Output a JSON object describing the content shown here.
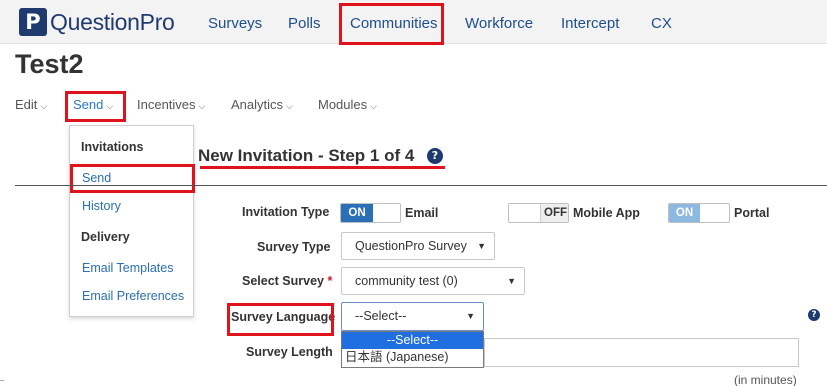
{
  "app": {
    "logo_letter": "P",
    "logo_text": "QuestionPro"
  },
  "topnav": {
    "items": [
      "Surveys",
      "Polls",
      "Communities",
      "Workforce",
      "Intercept",
      "CX"
    ],
    "active": "Communities"
  },
  "page": {
    "title": "Test2"
  },
  "submenu": {
    "items": [
      "Edit",
      "Send",
      "Incentives",
      "Analytics",
      "Modules"
    ],
    "active": "Send"
  },
  "send_dropdown": {
    "invitations_header": "Invitations",
    "send": "Send",
    "history": "History",
    "delivery_header": "Delivery",
    "email_templates": "Email Templates",
    "email_preferences": "Email Preferences"
  },
  "section": {
    "title": "New Invitation - Step 1 of 4",
    "help": "?"
  },
  "form": {
    "invitation_type_label": "Invitation Type",
    "email_toggle": {
      "on_text": "ON",
      "label": "Email",
      "state": "on"
    },
    "mobile_toggle": {
      "off_text": "OFF",
      "label": "Mobile App",
      "state": "off"
    },
    "portal_toggle": {
      "on_text": "ON",
      "label": "Portal",
      "state": "on"
    },
    "survey_type_label": "Survey Type",
    "survey_type_value": "QuestionPro Survey",
    "select_survey_label": "Select Survey",
    "required_mark": "*",
    "select_survey_value": "community test (0)",
    "survey_language_label": "Survey Language",
    "survey_language_value": "--Select--",
    "survey_language_options": [
      "--Select--",
      "日本語 (Japanese)"
    ],
    "survey_language_help": "?",
    "survey_length_label": "Survey Length",
    "survey_length_hint": "(in minutes)"
  },
  "colors": {
    "brand": "#1f3a6e",
    "link": "#2a6fb0",
    "highlight": "#e0121b",
    "toggle_on": "#2b6fb6"
  }
}
